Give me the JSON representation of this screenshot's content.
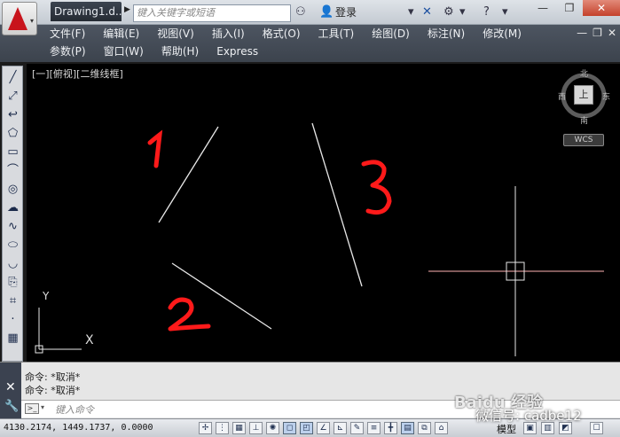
{
  "titlebar": {
    "doc_title": "Drawing1.d...",
    "search_placeholder": "键入关键字或短语",
    "login_label": "登录"
  },
  "menus": {
    "row1": [
      "文件(F)",
      "编辑(E)",
      "视图(V)",
      "插入(I)",
      "格式(O)",
      "工具(T)",
      "绘图(D)",
      "标注(N)",
      "修改(M)"
    ],
    "row2": [
      "参数(P)",
      "窗口(W)",
      "帮助(H)",
      "Express"
    ]
  },
  "viewport": {
    "label": "[一][俯视][二维线框]",
    "viewcube_face": "上",
    "compass": {
      "north": "北",
      "south": "南",
      "east": "东",
      "west": "西"
    },
    "wcs_label": "WCS",
    "ucs": {
      "y": "Y",
      "x": "X"
    }
  },
  "annotations": {
    "one": "1",
    "two": "2",
    "three": "3"
  },
  "command": {
    "history": [
      "命令: *取消*",
      "命令: *取消*"
    ],
    "input_placeholder": "键入命令"
  },
  "status": {
    "coords": "4130.2174, 1449.1737, 0.0000",
    "model_label": "模型"
  },
  "watermark": {
    "brand": "Baidu 经验",
    "account": "微信号: cadbe12"
  },
  "colors": {
    "canvas_bg": "#000000",
    "line": "#e8e8e8",
    "annotation": "#ff1a1a",
    "crosshair_h": "#ffb3b3"
  }
}
